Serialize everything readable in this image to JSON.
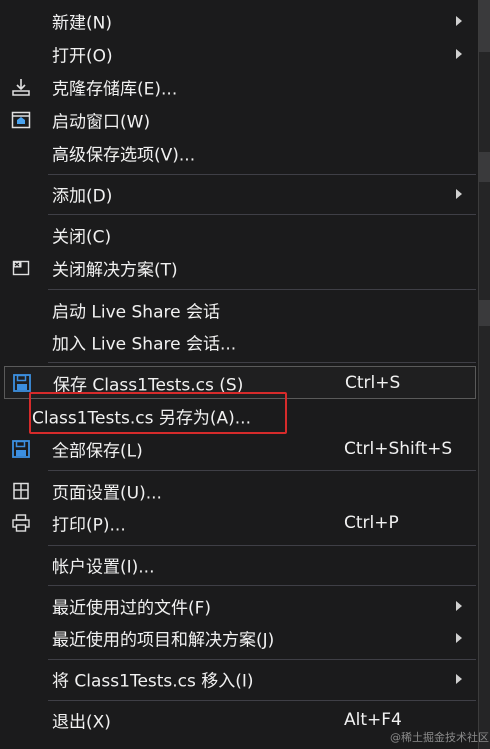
{
  "colors": {
    "menu_background": "#1b1b1c",
    "text": "#f1f1f1",
    "separator": "#3f3f46",
    "highlight_border": "#5a5a5a",
    "annotation_red": "#d62b2b",
    "save_icon_blue": "#3c8fe0"
  },
  "menu": {
    "items": [
      {
        "label": "新建(N)",
        "submenu": true
      },
      {
        "label": "打开(O)",
        "submenu": true
      },
      {
        "label": "克隆存储库(E)...",
        "icon": "clone-download-icon"
      },
      {
        "label": "启动窗口(W)",
        "icon": "start-window-icon"
      },
      {
        "label": "高级保存选项(V)..."
      },
      {
        "label": "添加(D)",
        "submenu": true
      },
      {
        "label": "关闭(C)"
      },
      {
        "label": "关闭解决方案(T)",
        "icon": "close-solution-icon"
      },
      {
        "label": "启动 Live Share 会话"
      },
      {
        "label": "加入 Live Share 会话..."
      },
      {
        "label": "保存 Class1Tests.cs (S)",
        "shortcut": "Ctrl+S",
        "icon": "save-icon"
      },
      {
        "label": "Class1Tests.cs 另存为(A)..."
      },
      {
        "label": "全部保存(L)",
        "shortcut": "Ctrl+Shift+S",
        "icon": "save-all-icon"
      },
      {
        "label": "页面设置(U)...",
        "icon": "page-setup-icon"
      },
      {
        "label": "打印(P)...",
        "shortcut": "Ctrl+P",
        "icon": "printer-icon"
      },
      {
        "label": "帐户设置(I)..."
      },
      {
        "label": "最近使用过的文件(F)",
        "submenu": true
      },
      {
        "label": "最近使用的项目和解决方案(J)",
        "submenu": true
      },
      {
        "label": "将 Class1Tests.cs 移入(I)",
        "submenu": true
      },
      {
        "label": "退出(X)",
        "shortcut": "Alt+F4"
      }
    ]
  },
  "watermark": "@稀土掘金技术社区"
}
